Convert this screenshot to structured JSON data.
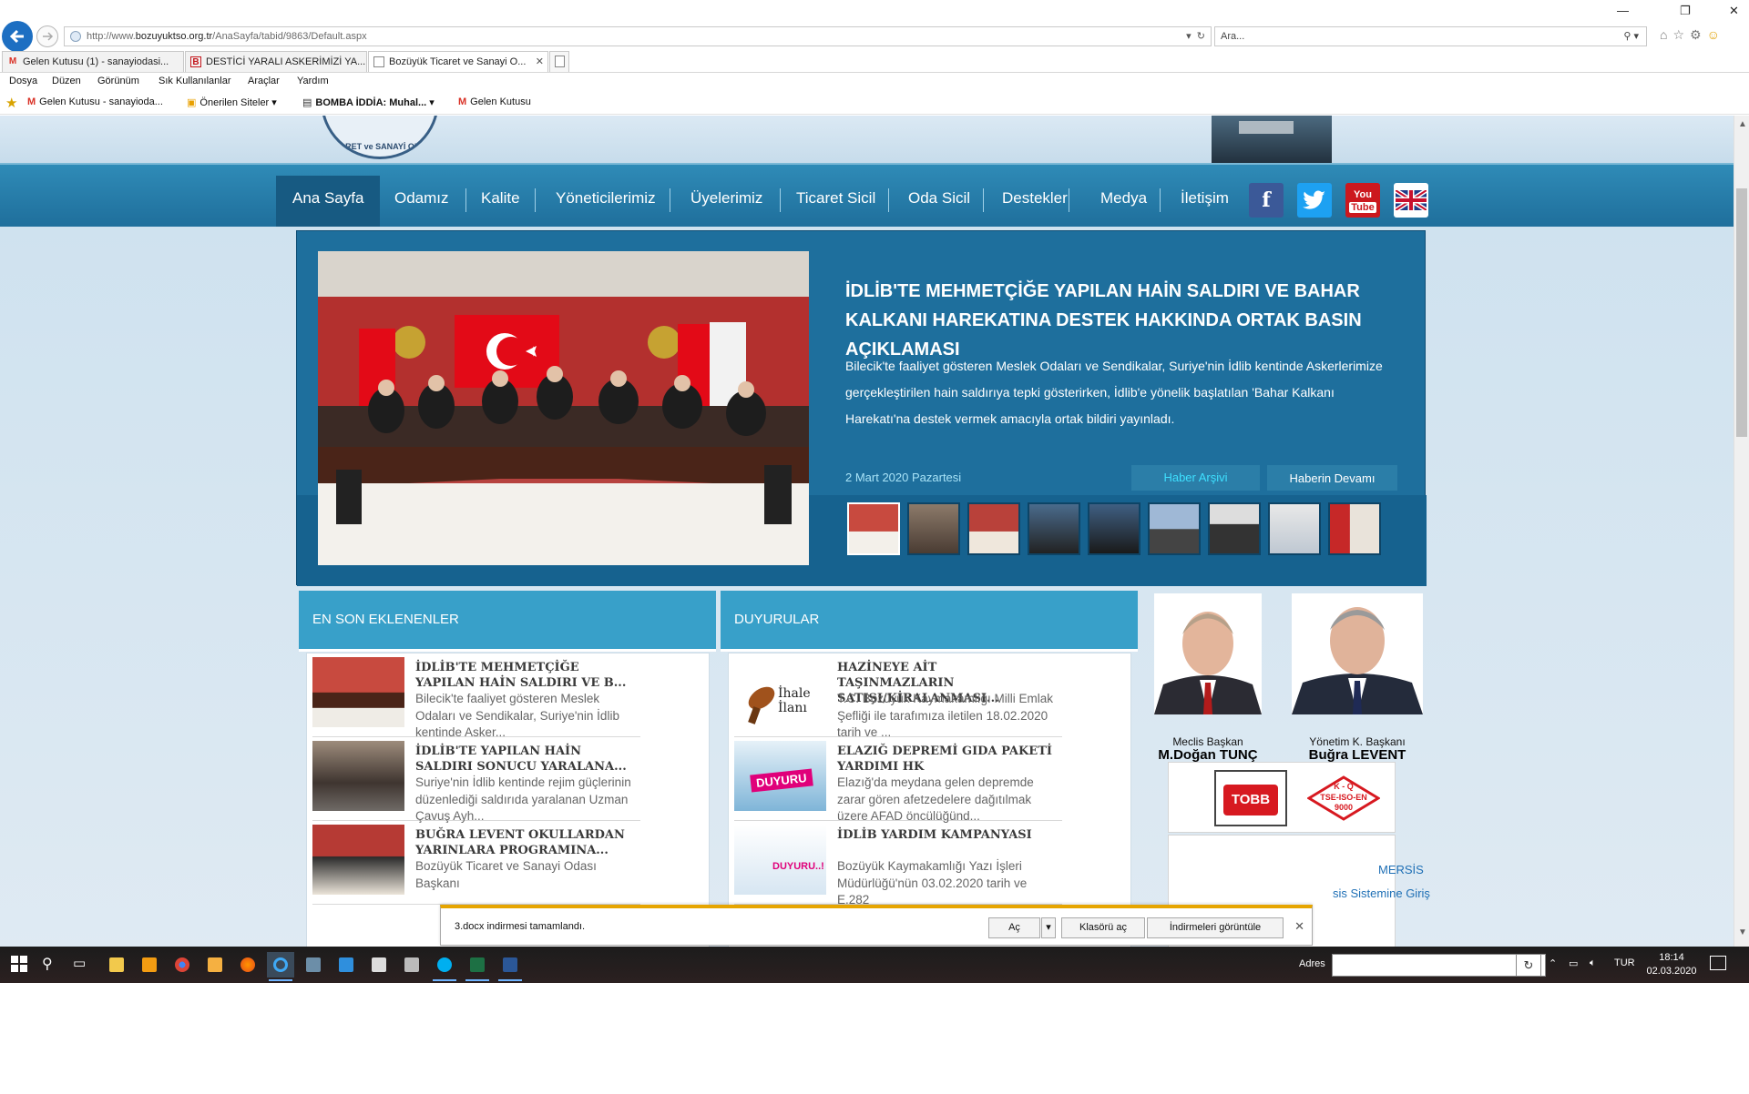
{
  "browser": {
    "url_prefix": "http://www.",
    "url_domain": "bozuyuktso.org.tr",
    "url_path": "/AnaSayfa/tabid/9863/Default.aspx",
    "search_placeholder": "Ara...",
    "tabs": [
      {
        "label": "Gelen Kutusu (1) - sanayiodasi...",
        "icon": "gmail-icon"
      },
      {
        "label": "DESTİCİ YARALI ASKERİMİZİ YA...",
        "icon": "b-news-icon"
      },
      {
        "label": "Bozüyük Ticaret ve Sanayi O...",
        "icon": "ie-page-icon",
        "active": true
      }
    ],
    "menu": [
      "Dosya",
      "Düzen",
      "Görünüm",
      "Sık Kullanılanlar",
      "Araçlar",
      "Yardım"
    ],
    "favorites": [
      {
        "label": "Gelen Kutusu - sanayioda...",
        "icon": "gmail-icon"
      },
      {
        "label": "Önerilen Siteler ▾",
        "icon": "suggested-sites-icon"
      },
      {
        "label": "BOMBA İDDİA: Muhal... ▾",
        "icon": "news-icon"
      },
      {
        "label": "Gelen Kutusu",
        "icon": "gmail-icon"
      }
    ]
  },
  "site": {
    "logo_text": "ARET ve SANAYİ OD",
    "nav": [
      "Ana Sayfa",
      "Odamız",
      "Kalite",
      "Yöneticilerimiz",
      "Üyelerimiz",
      "Ticaret Sicil",
      "Oda Sicil",
      "Destekler",
      "Medya",
      "İletişim"
    ],
    "social": [
      {
        "name": "facebook",
        "glyph": "f",
        "color": "#3b5998"
      },
      {
        "name": "twitter",
        "glyph": "t",
        "color": "#1da1f2"
      },
      {
        "name": "youtube",
        "glyph": "You",
        "color": "#cc181e"
      },
      {
        "name": "english",
        "glyph": "",
        "color": "#1f3c88"
      }
    ],
    "slider": {
      "title": "İDLİB'TE MEHMETÇİĞE YAPILAN HAİN SALDIRI VE BAHAR KALKANI HAREKATINA DESTEK HAKKINDA ORTAK BASIN AÇIKLAMASI",
      "text": "Bilecik'te faaliyet gösteren Meslek Odaları ve Sendikalar, Suriye'nin İdlib kentinde Askerlerimize gerçekleştirilen hain saldırıya tepki gösterirken, İdlib'e yönelik başlatılan 'Bahar Kalkanı Harekatı'na destek vermek amacıyla ortak bildiri yayınladı.",
      "date": "2 Mart 2020 Pazartesi",
      "archive_label": "Haber Arşivi",
      "more_label": "Haberin Devamı"
    },
    "latest": {
      "heading": "EN SON EKLENENLER",
      "items": [
        {
          "title": "İDLİB'TE MEHMETÇİĞE YAPILAN HAİN SALDIRI VE B...",
          "text": "Bilecik'te faaliyet gösteren Meslek Odaları ve Sendikalar, Suriye'nin İdlib kentinde Asker..."
        },
        {
          "title": "İDLİB'TE YAPILAN HAİN SALDIRI SONUCU YARALANA...",
          "text": "Suriye'nin İdlib kentinde rejim güçlerinin düzenlediği saldırıda yaralanan Uzman Çavuş Ayh..."
        },
        {
          "title": "BUĞRA LEVENT OKULLARDAN YARINLARA PROGRAMINA...",
          "text": "Bozüyük Ticaret ve Sanayi Odası Başkanı"
        }
      ]
    },
    "announcements": {
      "heading": "DUYURULAR",
      "items": [
        {
          "title": "HAZİNEYE AİT TAŞINMAZLARIN SATIŞI/KİRALANMASI...",
          "text": "T.C. Bozüyük Kaymakamlığı Milli Emlak Şefliği ile tarafımıza iletilen 18.02.2020 tarih ve ...",
          "thumb_label": "İhale İlanı"
        },
        {
          "title": "ELAZIĞ DEPREMİ GIDA PAKETİ YARDIMI HK",
          "text": "Elazığ'da meydana gelen depremde zarar gören afetzedelere dağıtılmak üzere AFAD öncülüğünd...",
          "thumb_label": "DUYURU"
        },
        {
          "title": "İDLİB YARDIM KAMPANYASI",
          "text": "Bozüyük Kaymakamlığı Yazı İşleri Müdürlüğü'nün 03.02.2020 tarih ve E.282",
          "thumb_label": "DUYURU..!"
        }
      ]
    },
    "presidents": [
      {
        "role": "Meclis Başkan",
        "name": "M.Doğan TUNÇ"
      },
      {
        "role": "Yönetim K. Başkanı",
        "name": "Buğra LEVENT"
      }
    ],
    "logos": {
      "tobb": "TOBB",
      "kq": "K - Q",
      "tse": "TSE-ISO-EN",
      "num": "9000"
    },
    "mersis": {
      "label": "MERSİS",
      "text": "sis Sistemine Giriş"
    }
  },
  "download_bar": {
    "message": "3.docx indirmesi tamamlandı.",
    "open_label": "Aç",
    "folder_label": "Klasörü aç",
    "view_label": "İndirmeleri görüntüle"
  },
  "taskbar": {
    "address_label": "Adres",
    "lang": "TUR",
    "time": "18:14",
    "date": "02.03.2020"
  }
}
